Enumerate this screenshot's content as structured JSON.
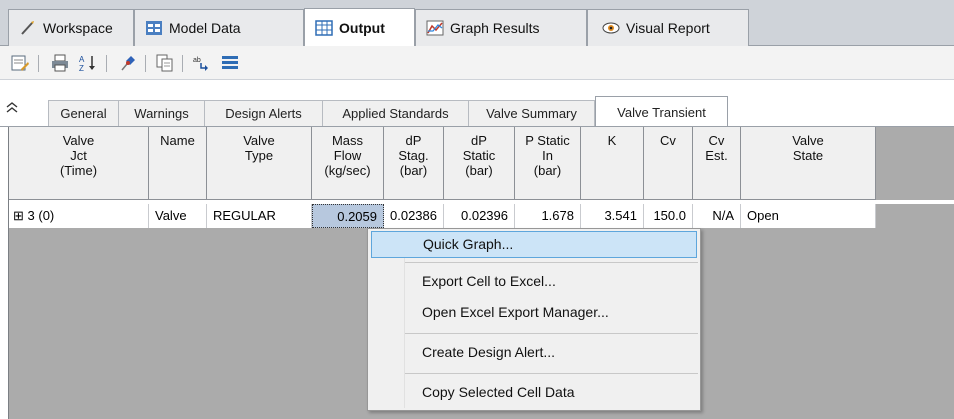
{
  "main_tabs": [
    {
      "label": "Workspace",
      "icon": "workspace-icon"
    },
    {
      "label": "Model Data",
      "icon": "model-data-icon"
    },
    {
      "label": "Output",
      "icon": "output-table-icon",
      "active": true
    },
    {
      "label": "Graph Results",
      "icon": "graph-icon"
    },
    {
      "label": "Visual Report",
      "icon": "eye-icon"
    }
  ],
  "toolbar": {
    "icons": [
      "modify-output-icon",
      "print-icon",
      "sort-icon",
      "pin-icon",
      "copy-icon",
      "transpose-icon",
      "list-icon"
    ]
  },
  "sub_tabs": [
    {
      "label": "General"
    },
    {
      "label": "Warnings"
    },
    {
      "label": "Design Alerts"
    },
    {
      "label": "Applied Standards"
    },
    {
      "label": "Valve Summary"
    },
    {
      "label": "Valve Transient",
      "active": true
    }
  ],
  "table": {
    "headers": [
      "Valve\nJct\n(Time)",
      "Name",
      "Valve\nType",
      "Mass\nFlow\n(kg/sec)",
      "dP\nStag.\n(bar)",
      "dP\nStatic\n(bar)",
      "P Static\nIn\n(bar)",
      "K",
      "Cv",
      "Cv\nEst.",
      "Valve\nState"
    ],
    "row": {
      "expander": "⊞",
      "jct": "3 (0)",
      "name": "Valve",
      "type": "REGULAR",
      "mass_flow": "0.2059",
      "dp_stag": "0.02386",
      "dp_static": "0.02396",
      "p_static_in": "1.678",
      "k": "3.541",
      "cv": "150.0",
      "cv_est": "N/A",
      "state": "Open"
    }
  },
  "context_menu": {
    "items": [
      "Quick Graph...",
      "Export Cell to Excel...",
      "Open Excel Export Manager...",
      "Create Design Alert...",
      "Copy Selected Cell Data"
    ]
  },
  "colors": {
    "tab_bar": "#cfd3d9",
    "selected_cell": "#b7c8de",
    "menu_highlight": "#cce4f7",
    "menu_highlight_border": "#5ea6dc",
    "grid_background": "#ababab"
  }
}
